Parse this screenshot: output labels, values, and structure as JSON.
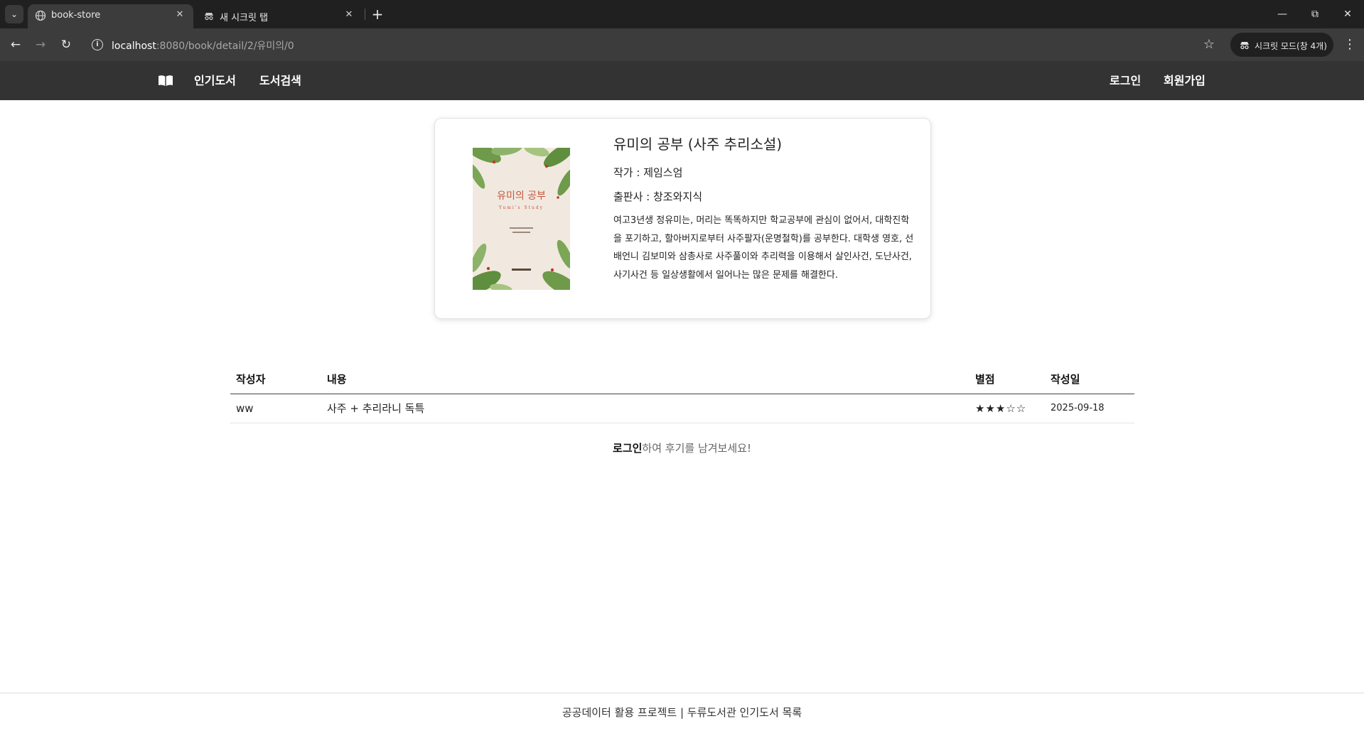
{
  "browser": {
    "tabs": [
      {
        "title": "book-store",
        "active": true,
        "icon": "globe-icon"
      },
      {
        "title": "새 시크릿 탭",
        "active": false,
        "icon": "incognito-icon"
      }
    ],
    "url_host": "localhost",
    "url_rest": ":8080/book/detail/2/유미의/0",
    "incognito_label": "시크릿 모드(창 4개)"
  },
  "site": {
    "nav": {
      "logo_icon": "book-open-icon",
      "popular": "인기도서",
      "search": "도서검색",
      "login": "로그인",
      "signup": "회원가입"
    }
  },
  "book": {
    "title": "유미의 공부 (사주 추리소설)",
    "author": "작가 : 제임스엄",
    "publisher": "출판사 : 창조와지식",
    "description": "여고3년생 정유미는, 머리는 똑똑하지만 학교공부에 관심이 없어서, 대학진학을 포기하고, 할아버지로부터 사주팔자(운명철학)를 공부한다. 대학생 영호, 선배언니 김보미와 삼총사로 사주풀이와 추리력을 이용해서 살인사건, 도난사건, 사기사건 등 일상생활에서 일어나는 많은 문제를 해결한다.",
    "cover": {
      "title": "유미의 공부",
      "subtitle": "Yumi's Study",
      "colors": {
        "background": "#f1e9df",
        "title": "#c8553d",
        "leaf": "#5f8f3e"
      }
    }
  },
  "reviews": {
    "headers": {
      "writer": "작성자",
      "content": "내용",
      "rating": "별점",
      "date": "작성일"
    },
    "rows": [
      {
        "writer": "ww",
        "content": "사주 + 추리라니 독특",
        "rating": 3,
        "rating_max": 5,
        "stars": "★★★☆☆",
        "date": "2025-09-18"
      }
    ],
    "star_color": "#e3a418"
  },
  "login_prompt": {
    "link": "로그인",
    "rest": "하여 후기를 남겨보세요!"
  },
  "footer": "공공데이터 활용 프로젝트 | 두류도서관 인기도서 목록"
}
